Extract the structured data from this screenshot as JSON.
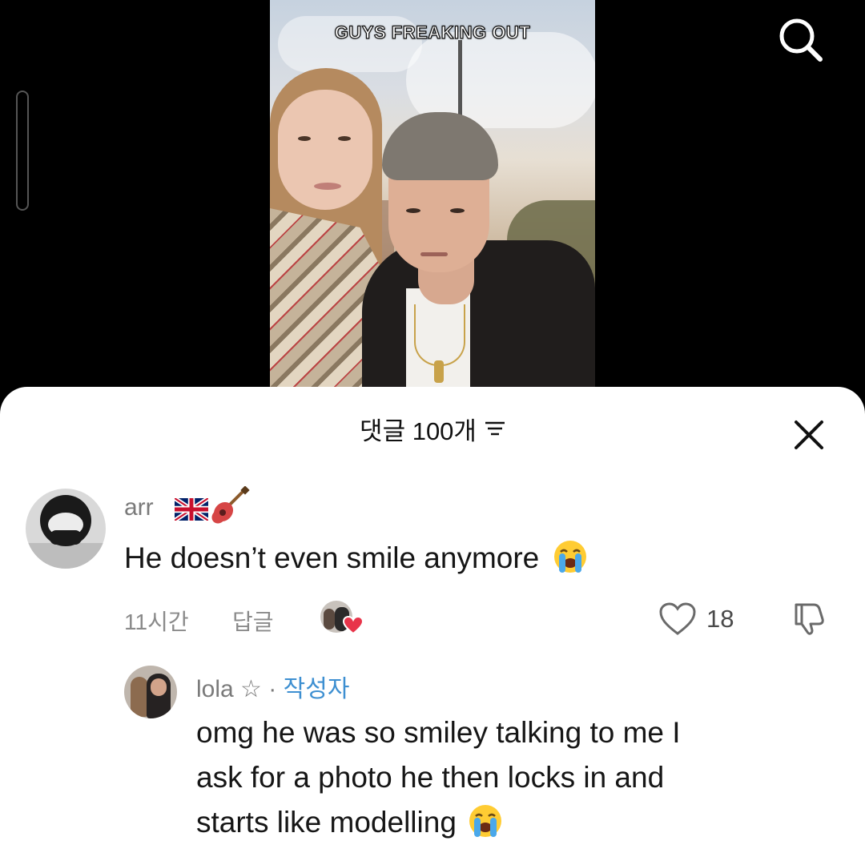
{
  "video": {
    "overlay_text": "GUYS FREAKING OUT"
  },
  "topbar": {
    "search_icon": "search-icon"
  },
  "sheet": {
    "title": "댓글 100개",
    "filter_icon": "filter-icon",
    "close_icon": "close-icon"
  },
  "comments": [
    {
      "username": "arr",
      "username_emojis": [
        "uk-flag-icon",
        "guitar-icon"
      ],
      "text": "He doesn’t even smile anymore",
      "emoji": "crying-face-icon",
      "time": "11시간",
      "reply_label": "답글",
      "like_count": "18"
    }
  ],
  "reply": {
    "username": "lola ☆",
    "separator": "·",
    "author_label": "작성자",
    "text_line1": "omg he was so smiley talking to me I",
    "text_line2": "ask for a photo he then locks in and",
    "text_line3": "starts like modelling",
    "emoji": "crying-face-icon"
  },
  "colors": {
    "sheet_bg": "#ffffff",
    "text_primary": "#161616",
    "text_secondary": "#8a8a8a",
    "author_accent": "#3d8fd1",
    "heart": "#e8344a"
  }
}
